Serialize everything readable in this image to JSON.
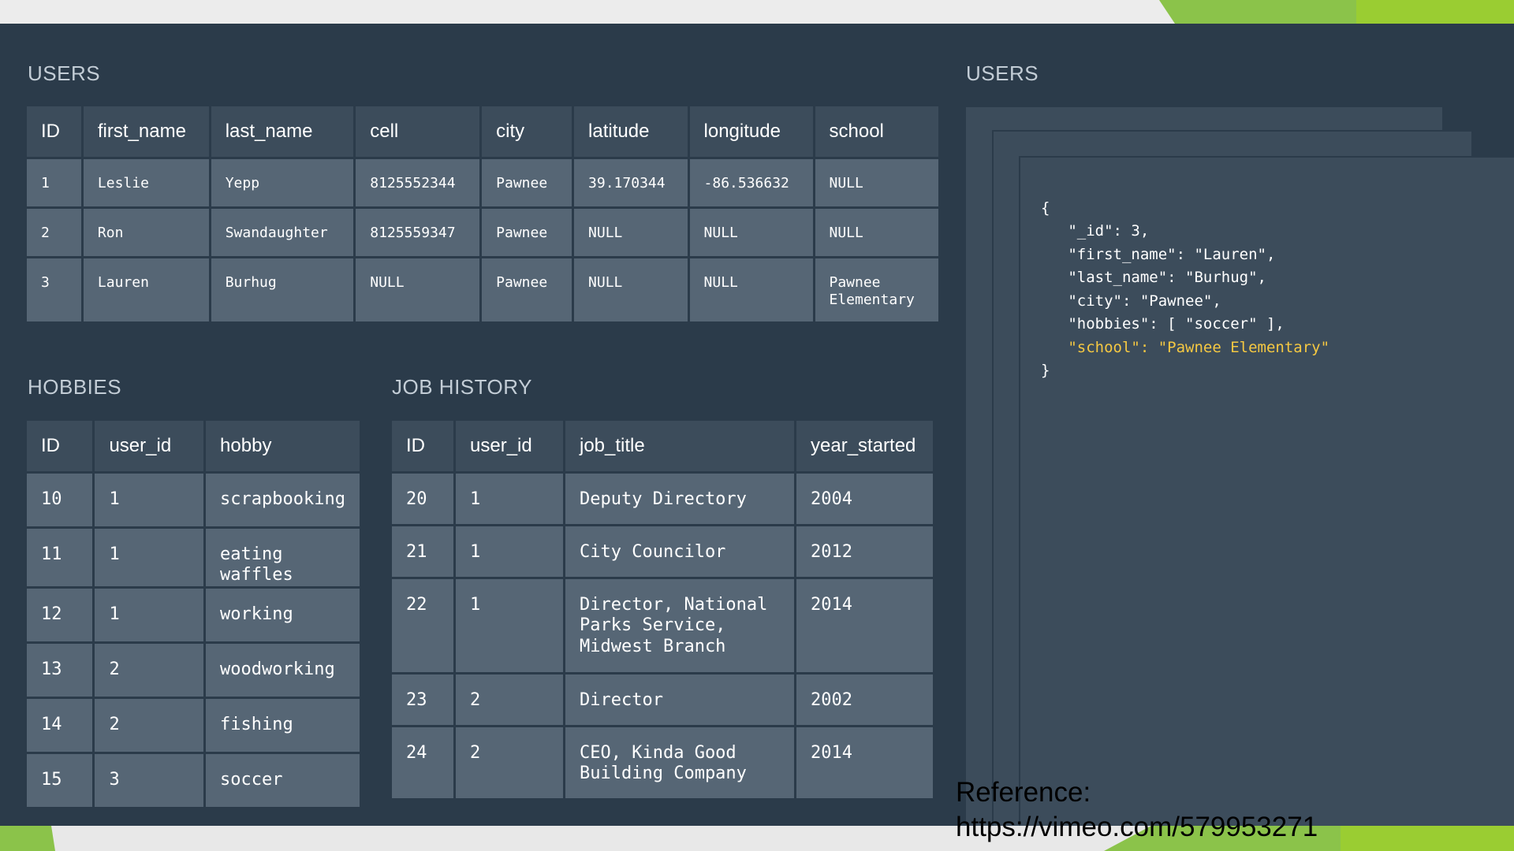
{
  "users_section": {
    "title": "USERS",
    "columns": [
      "ID",
      "first_name",
      "last_name",
      "cell",
      "city",
      "latitude",
      "longitude",
      "school"
    ],
    "rows": [
      [
        "1",
        "Leslie",
        "Yepp",
        "8125552344",
        "Pawnee",
        "39.170344",
        "-86.536632",
        "NULL"
      ],
      [
        "2",
        "Ron",
        "Swandaughter",
        "8125559347",
        "Pawnee",
        "NULL",
        "NULL",
        "NULL"
      ],
      [
        "3",
        "Lauren",
        "Burhug",
        "NULL",
        "Pawnee",
        "NULL",
        "NULL",
        "Pawnee Elementary"
      ]
    ]
  },
  "hobbies_section": {
    "title": "HOBBIES",
    "columns": [
      "ID",
      "user_id",
      "hobby"
    ],
    "rows": [
      [
        "10",
        "1",
        "scrapbooking"
      ],
      [
        "11",
        "1",
        "eating waffles"
      ],
      [
        "12",
        "1",
        "working"
      ],
      [
        "13",
        "2",
        "woodworking"
      ],
      [
        "14",
        "2",
        "fishing"
      ],
      [
        "15",
        "3",
        "soccer"
      ]
    ]
  },
  "jobs_section": {
    "title": "JOB HISTORY",
    "columns": [
      "ID",
      "user_id",
      "job_title",
      "year_started"
    ],
    "rows": [
      [
        "20",
        "1",
        "Deputy Directory",
        "2004"
      ],
      [
        "21",
        "1",
        "City Councilor",
        "2012"
      ],
      [
        "22",
        "1",
        "Director, National Parks Service, Midwest Branch",
        "2014"
      ],
      [
        "23",
        "2",
        "Director",
        "2002"
      ],
      [
        "24",
        "2",
        "CEO, Kinda Good Building Company",
        "2014"
      ]
    ]
  },
  "document_section": {
    "title": "USERS",
    "json_lines": [
      "{",
      "   \"_id\": 3,",
      "   \"first_name\": \"Lauren\",",
      "   \"last_name\": \"Burhug\",",
      "   \"city\": \"Pawnee\",",
      "   \"hobbies\": [ \"soccer\" ],",
      "   \"school\": \"Pawnee Elementary\"",
      "}"
    ],
    "highlighted_line_index": 6
  },
  "reference": {
    "label": "Reference:",
    "url": "https://vimeo.com/579953271"
  },
  "colors": {
    "panel_bg": "#2b3b4a",
    "header_cell": "#3c4c5b",
    "data_cell": "#566675",
    "highlight": "#f5c842",
    "accent_green": "#8bc34a"
  }
}
